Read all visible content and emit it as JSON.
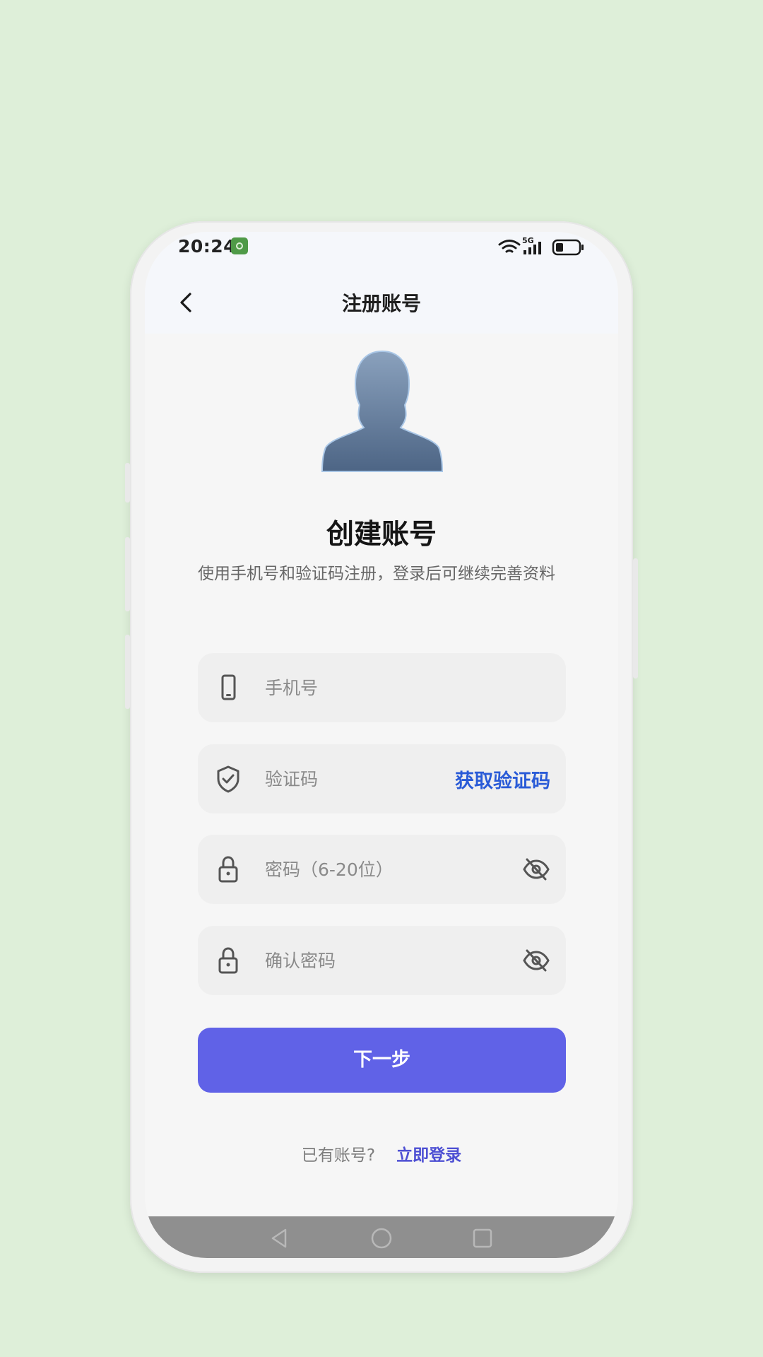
{
  "status_bar": {
    "time": "20:24",
    "network": "5G",
    "icons": [
      "app-notification-icon",
      "wifi-icon",
      "signal-icon",
      "battery-icon"
    ]
  },
  "nav": {
    "title": "注册账号",
    "back_icon": "chevron-left-icon"
  },
  "header": {
    "avatar_icon": "user-avatar-icon",
    "title": "创建账号",
    "subtitle": "使用手机号和验证码注册，登录后可继续完善资料"
  },
  "form": {
    "phone": {
      "placeholder": "手机号",
      "value": "",
      "icon": "phone-icon"
    },
    "code": {
      "placeholder": "验证码",
      "value": "",
      "icon": "shield-check-icon",
      "action_label": "获取验证码"
    },
    "password": {
      "placeholder": "密码（6-20位）",
      "value": "",
      "icon": "lock-icon",
      "toggle_icon": "eye-off-icon"
    },
    "confirm_password": {
      "placeholder": "确认密码",
      "value": "",
      "icon": "lock-icon",
      "toggle_icon": "eye-off-icon"
    }
  },
  "actions": {
    "next_label": "下一步",
    "have_account": "已有账号?",
    "login_label": "立即登录"
  },
  "system_nav": [
    "back-triangle-icon",
    "home-circle-icon",
    "recents-square-icon"
  ],
  "colors": {
    "background": "#deefd9",
    "primary": "#6062e7",
    "link": "#2a5bd7",
    "login_link": "#4d4fd3"
  }
}
